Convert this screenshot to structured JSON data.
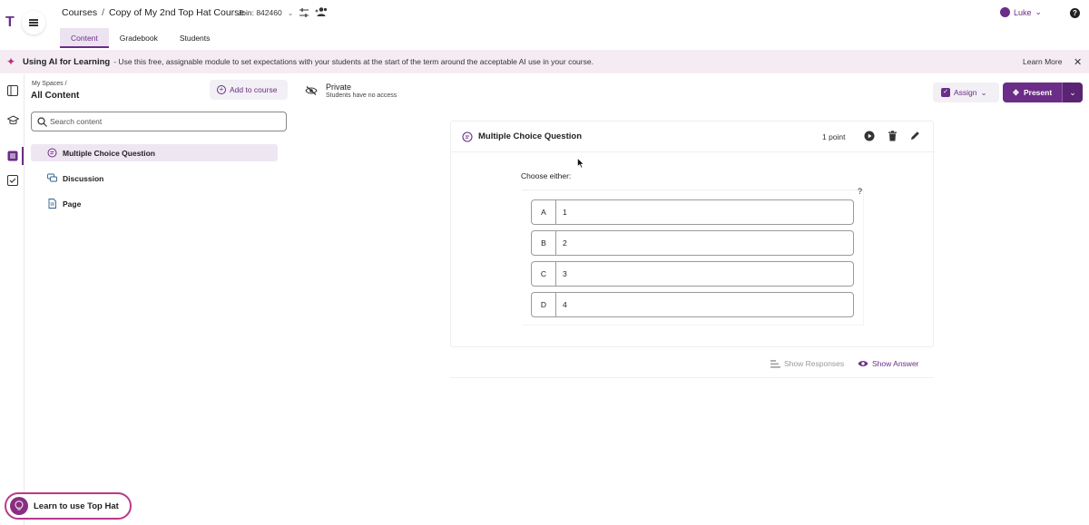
{
  "header": {
    "logo_text": "T",
    "breadcrumb_root": "Courses",
    "breadcrumb_sep": "/",
    "course_title": "Copy of My 2nd Top Hat Course",
    "join_label": "Join: 842460",
    "user_name": "Luke",
    "help_icon": "?"
  },
  "tabs": [
    {
      "label": "Content",
      "active": true
    },
    {
      "label": "Gradebook",
      "active": false
    },
    {
      "label": "Students",
      "active": false
    }
  ],
  "banner": {
    "title": "Using AI for Learning",
    "text": "- Use this free, assignable module to set expectations with your students at the start of the term around the acceptable AI use in your course.",
    "learn_more": "Learn More",
    "close_icon": "close-icon"
  },
  "content_panel": {
    "spaces_crumb": "My Spaces  /",
    "title": "All Content",
    "add_button": "Add to course",
    "search_placeholder": "Search content",
    "items": [
      {
        "label": "Multiple Choice Question",
        "selected": true,
        "icon": "question-bubble-icon"
      },
      {
        "label": "Discussion",
        "selected": false,
        "icon": "discussion-icon"
      },
      {
        "label": "Page",
        "selected": false,
        "icon": "page-icon"
      }
    ]
  },
  "privacy": {
    "title": "Private",
    "subtitle": "Students have no access"
  },
  "actions": {
    "assign": "Assign",
    "present": "Present"
  },
  "question": {
    "type_title": "Multiple Choice Question",
    "points": "1 point",
    "prompt": "Choose either:",
    "help_mark": "?",
    "options": [
      {
        "letter": "A",
        "value": "1"
      },
      {
        "letter": "B",
        "value": "2"
      },
      {
        "letter": "C",
        "value": "3"
      },
      {
        "letter": "D",
        "value": "4"
      }
    ],
    "show_responses": "Show Responses",
    "show_answer": "Show Answer"
  },
  "footer": {
    "learn_label": "Learn to use Top Hat"
  },
  "colors": {
    "brand": "#6b2d87",
    "banner_bg": "#f5ecf3",
    "selected_bg": "#eee7f2"
  }
}
